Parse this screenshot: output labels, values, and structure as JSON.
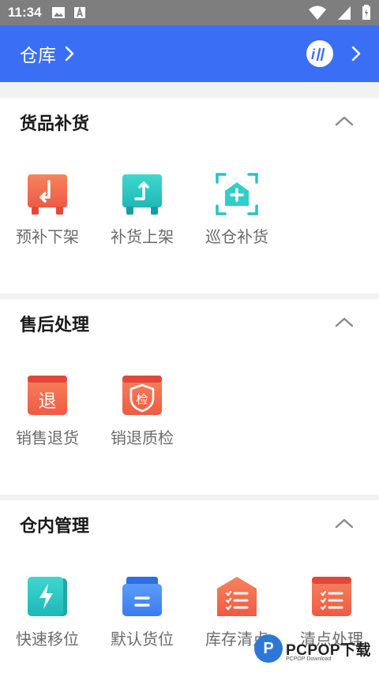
{
  "status_bar": {
    "time": "11:34",
    "icons": [
      "image-icon",
      "a-icon",
      "wifi-icon",
      "signal-icon",
      "battery-icon"
    ]
  },
  "header": {
    "title": "仓库",
    "avatar_text": "i"
  },
  "sections": [
    {
      "title": "货品补货",
      "items": [
        {
          "label": "预补下架",
          "icon": "pre-replenish-down-icon"
        },
        {
          "label": "补货上架",
          "icon": "replenish-up-icon"
        },
        {
          "label": "巡仓补货",
          "icon": "patrol-replenish-icon"
        }
      ]
    },
    {
      "title": "售后处理",
      "items": [
        {
          "label": "销售退货",
          "icon": "sales-return-icon",
          "glyph": "退"
        },
        {
          "label": "销退质检",
          "icon": "return-inspection-icon",
          "glyph": "检"
        }
      ]
    },
    {
      "title": "仓内管理",
      "items": [
        {
          "label": "快速移位",
          "icon": "quick-move-icon"
        },
        {
          "label": "默认货位",
          "icon": "default-location-icon"
        },
        {
          "label": "库存清点",
          "icon": "inventory-check-icon"
        },
        {
          "label": "清点处理",
          "icon": "check-process-icon"
        }
      ]
    }
  ],
  "watermark": {
    "logo": "P",
    "text": "PCPOP下载",
    "sub": "PCPOP Download"
  },
  "colors": {
    "header_bg": "#3a6ef5",
    "status_bg": "#7e7e7e",
    "orange": "#f26b4f",
    "teal": "#27c4c1",
    "blue": "#3f86f4"
  }
}
